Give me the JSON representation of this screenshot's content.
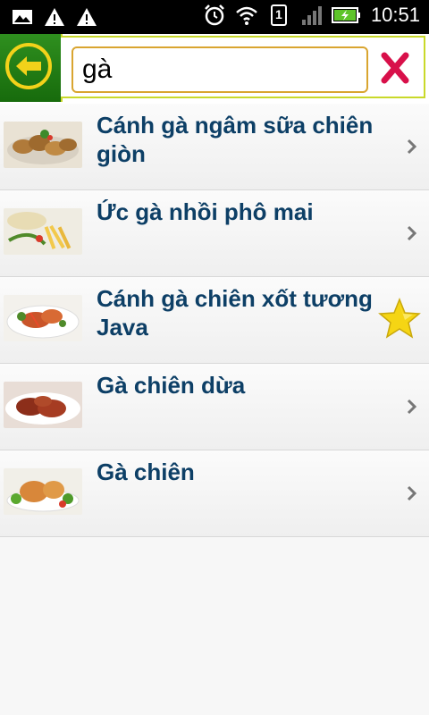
{
  "status_bar": {
    "time": "10:51",
    "sim_slot": "1",
    "icons": [
      "gallery-icon",
      "warning-icon",
      "warning-icon",
      "alarm-icon",
      "wifi-icon",
      "sim-icon",
      "signal-icon",
      "battery-charging-icon"
    ]
  },
  "search": {
    "value": "gà",
    "back_icon": "arrow-left-icon",
    "clear_icon": "close-x-icon"
  },
  "results": [
    {
      "title": "Cánh gà ngâm sữa chiên giòn",
      "thumb": "fried-chicken-wings",
      "marker": "chevron"
    },
    {
      "title": "Ức gà nhồi phô mai",
      "thumb": "stuffed-chicken-breast",
      "marker": "chevron"
    },
    {
      "title": "Cánh gà chiên xốt tương Java",
      "thumb": "chicken-wings-sauce",
      "marker": "star"
    },
    {
      "title": "Gà chiên dừa",
      "thumb": "coconut-fried-chicken",
      "marker": "chevron"
    },
    {
      "title": "Gà chiên",
      "thumb": "fried-chicken",
      "marker": "chevron"
    }
  ],
  "colors": {
    "title": "#0d3f66",
    "header_green": "#2f8f1f",
    "header_accent": "#c9d92a",
    "clear_red": "#d8104a",
    "star": "#f5d514"
  }
}
